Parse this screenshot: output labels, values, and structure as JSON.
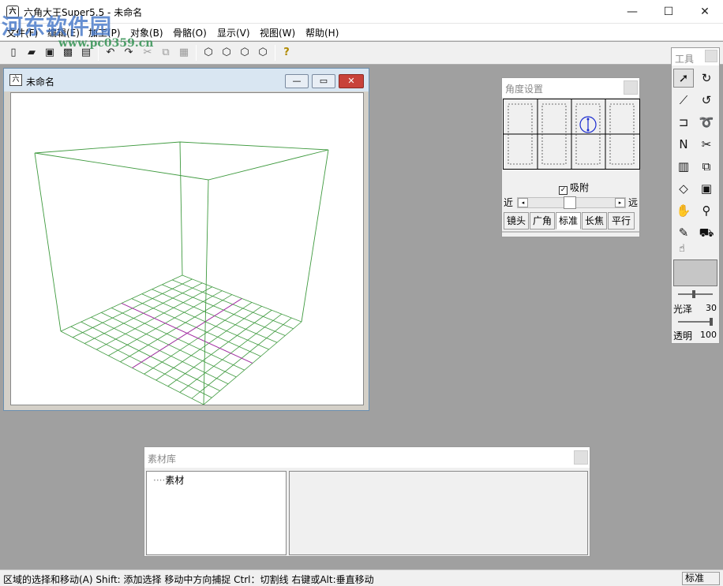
{
  "app": {
    "title": "六角大王Super5.5 - 未命名",
    "icon_text": "六"
  },
  "window_controls": {
    "minimize": "—",
    "maximize": "☐",
    "close": "✕"
  },
  "watermark": {
    "text": "河东软件园",
    "url": "www.pc0359.cn"
  },
  "menu": {
    "items": [
      {
        "label": "文件(F)"
      },
      {
        "label": "编辑(E)"
      },
      {
        "label": "加工(P)"
      },
      {
        "label": "对象(B)"
      },
      {
        "label": "骨骼(O)"
      },
      {
        "label": "显示(V)"
      },
      {
        "label": "视图(W)"
      },
      {
        "label": "帮助(H)"
      }
    ]
  },
  "toolbar": {
    "icons": [
      "new-file-icon",
      "open-file-icon",
      "save-icon",
      "save-as-icon",
      "print-icon",
      "undo-icon",
      "redo-icon",
      "cut-icon",
      "copy-icon",
      "paste-icon",
      "cube-view-1-icon",
      "cube-view-2-icon",
      "cube-view-3-icon",
      "cube-view-4-icon",
      "help-icon"
    ],
    "glyphs": [
      "▯",
      "▰",
      "▣",
      "▩",
      "▤",
      "↶",
      "↷",
      "✂",
      "⧉",
      "▦",
      "⬡",
      "⬡",
      "⬡",
      "⬡",
      "?"
    ]
  },
  "document": {
    "title": "未命名",
    "icon_text": "六",
    "controls": {
      "minimize": "—",
      "maximize": "▭",
      "close": "✕"
    }
  },
  "angle_panel": {
    "title": "角度设置",
    "snap_label": "吸附",
    "snap_checked": true,
    "snap_mark": "✓",
    "near_label": "近",
    "far_label": "远",
    "slider_left": "◂",
    "slider_right": "▸",
    "slider_value": 0.5,
    "lens_tabs": [
      {
        "label": "镜头",
        "active": false
      },
      {
        "label": "广角",
        "active": false
      },
      {
        "label": "标准",
        "active": true
      },
      {
        "label": "长焦",
        "active": false
      },
      {
        "label": "平行",
        "active": false
      }
    ]
  },
  "tools_panel": {
    "title": "工具",
    "tools": [
      {
        "name": "select-arrow-icon",
        "glyph": "➚",
        "selected": true
      },
      {
        "name": "rotate-icon",
        "glyph": "↻",
        "selected": false
      },
      {
        "name": "knife-icon",
        "glyph": "⟋",
        "selected": false
      },
      {
        "name": "rotate-point-icon",
        "glyph": "↺",
        "selected": false
      },
      {
        "name": "bracket-icon",
        "glyph": "⊐",
        "selected": false
      },
      {
        "name": "lasso-icon",
        "glyph": "➰",
        "selected": false
      },
      {
        "name": "polyline-icon",
        "glyph": "Ν",
        "selected": false
      },
      {
        "name": "scissors-icon",
        "glyph": "✂",
        "selected": false
      },
      {
        "name": "extrude-icon",
        "glyph": "▥",
        "selected": false
      },
      {
        "name": "scale-icon",
        "glyph": "⧉",
        "selected": false
      },
      {
        "name": "face-icon",
        "glyph": "◇",
        "selected": false
      },
      {
        "name": "cube-icon",
        "glyph": "▣",
        "selected": false
      },
      {
        "name": "hand-icon",
        "glyph": "✋",
        "selected": false
      },
      {
        "name": "zoom-icon",
        "glyph": "⚲",
        "selected": false
      },
      {
        "name": "eyedropper-icon",
        "glyph": "✎",
        "selected": false
      },
      {
        "name": "paint-bucket-icon",
        "glyph": "⛟",
        "selected": false
      }
    ],
    "extra_tool": {
      "name": "paint-hand-icon",
      "glyph": "☝"
    },
    "swatch_color": "#c6c6c6",
    "gloss_label": "光泽",
    "gloss_value": "30",
    "transparency_label": "透明",
    "transparency_value": "100"
  },
  "library_panel": {
    "title": "素材库",
    "tree_item": "素材"
  },
  "statusbar": {
    "text": "区域的选择和移动(A)  Shift: 添加选择 移动中方向捕捉    Ctrl：切割线 右键或Alt:垂直移动",
    "mode": "标准"
  }
}
